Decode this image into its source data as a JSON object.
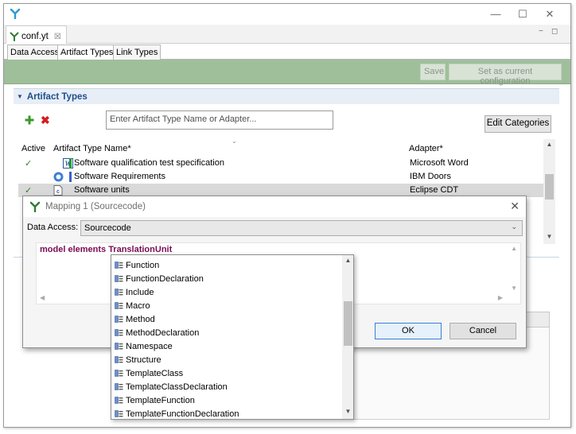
{
  "window": {
    "minimize_symbol": "—",
    "maximize_symbol": "☐",
    "close_symbol": "✕"
  },
  "editor_tab": {
    "label": "conf.yt",
    "close_symbol": "☒"
  },
  "view_controls": {
    "minimize": "−",
    "maximize": "◻"
  },
  "sub_tabs": [
    "Data Access",
    "Artifact Types",
    "Link Types"
  ],
  "toolbar": {
    "save_label": "Save",
    "set_current_label": "Set as current configuration"
  },
  "section": {
    "title": "Artifact Types"
  },
  "search": {
    "placeholder": "Enter Artifact Type Name or Adapter..."
  },
  "edit_categories_label": "Edit Categories",
  "table": {
    "headers": {
      "active": "Active",
      "name": "Artifact Type Name*",
      "adapter": "Adapter*"
    },
    "rows": [
      {
        "active": "✓",
        "icon": "word-icon",
        "color": "#1f9b3a",
        "name": "Software qualification test specification",
        "adapter": "Microsoft Word",
        "selected": false
      },
      {
        "active": "",
        "icon": "doors-icon",
        "color": "#3c5fc9",
        "name": "Software Requirements",
        "adapter": "IBM Doors",
        "selected": false
      },
      {
        "active": "✓",
        "icon": "cdt-icon",
        "color": "",
        "name": "Software units",
        "adapter": "Eclipse CDT",
        "selected": true
      }
    ]
  },
  "dialog": {
    "title": "Mapping 1 (Sourcecode)",
    "data_access_label": "Data Access:",
    "data_access_value": "Sourcecode",
    "code": "model elements TranslationUnit",
    "ok_label": "OK",
    "cancel_label": "Cancel"
  },
  "dropdown": {
    "items": [
      "Function",
      "FunctionDeclaration",
      "Include",
      "Macro",
      "Method",
      "MethodDeclaration",
      "Namespace",
      "Structure",
      "TemplateClass",
      "TemplateClassDeclaration",
      "TemplateFunction",
      "TemplateFunctionDeclaration"
    ]
  },
  "colors": {
    "accent_green": "#9fbf9b",
    "section_title": "#1f4e8c",
    "code_keyword": "#7a0b55",
    "ok_border": "#3b7dd8"
  }
}
